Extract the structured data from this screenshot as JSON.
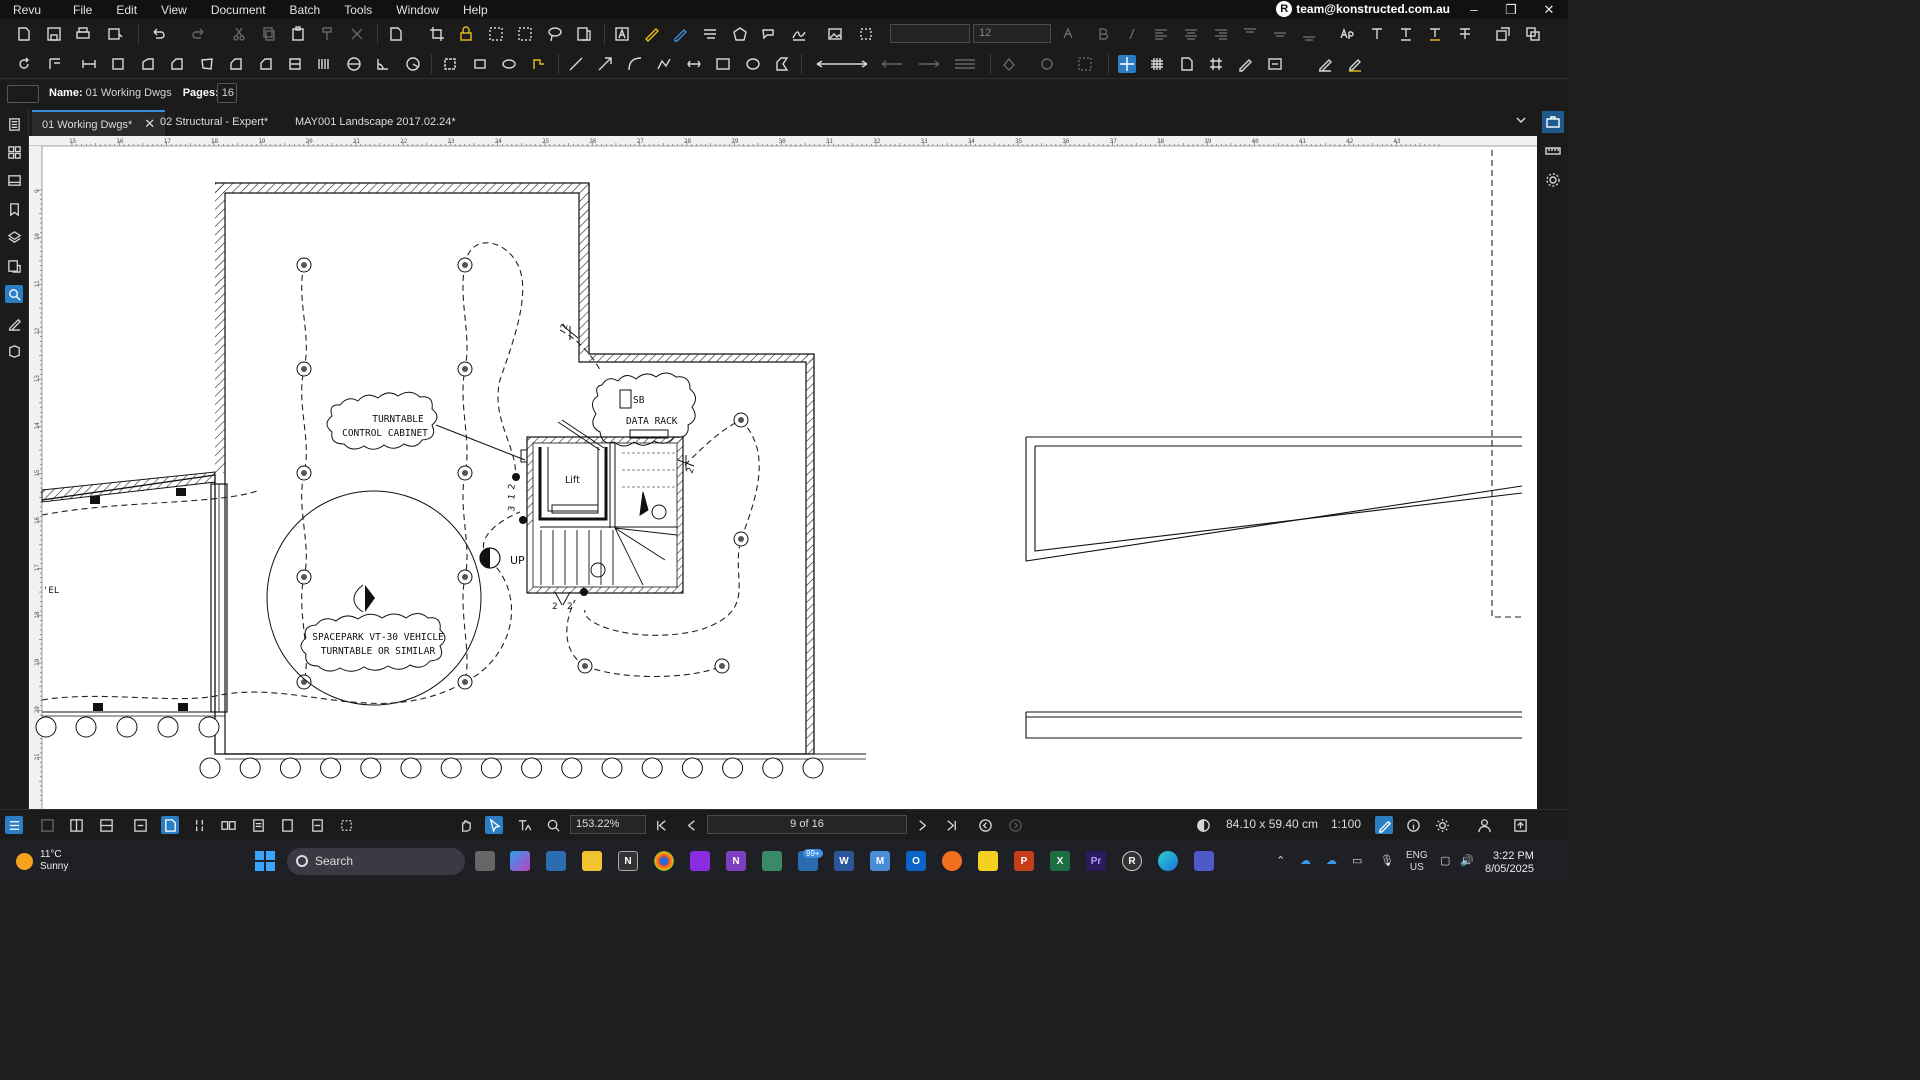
{
  "menu": [
    "Revu",
    "File",
    "Edit",
    "View",
    "Document",
    "Batch",
    "Tools",
    "Window",
    "Help"
  ],
  "account": "team@konstructed.com.au",
  "toolbar": {
    "font_size": "12"
  },
  "info": {
    "name_label": "Name:",
    "name_value": "01 Working Dwgs",
    "pages_label": "Pages:",
    "pages_value": "16"
  },
  "tabs": [
    {
      "label": "01 Working Dwgs*",
      "active": true
    },
    {
      "label": "02 Structural - Expert*",
      "active": false
    },
    {
      "label": "MAY001 Landscape 2017.02.24*",
      "active": false
    }
  ],
  "ruler_top": [
    "15",
    "16",
    "17",
    "18",
    "19",
    "20",
    "21",
    "22",
    "23",
    "24",
    "25",
    "26",
    "27",
    "28",
    "29",
    "30",
    "31",
    "32",
    "33",
    "34",
    "35",
    "36",
    "37",
    "38",
    "39",
    "40",
    "41",
    "42",
    "43"
  ],
  "ruler_left": [
    "9",
    "10",
    "11",
    "12",
    "13",
    "14",
    "15",
    "16",
    "17",
    "18",
    "19",
    "20",
    "21"
  ],
  "drawing": {
    "labels": {
      "cab1": "TURNTABLE",
      "cab2": "CONTROL CABINET",
      "sb": "SB",
      "rack": "DATA RACK",
      "lift": "Lift",
      "up": "UP",
      "tt1": "SPACEPARK VT-30 VEHICLE",
      "tt2": "TURNTABLE OR SIMILAR",
      "el": "'EL",
      "n2a": "2",
      "n2b": "2",
      "n2c": "2",
      "n2d": "2",
      "n3": "3",
      "n1": "1",
      "n2e": "2"
    }
  },
  "bottom": {
    "zoom": "153.22%",
    "page": "9 of 16",
    "sheet_size": "84.10 x 59.40 cm",
    "scale": "1:100"
  },
  "taskbar": {
    "temp": "11°C",
    "condition": "Sunny",
    "search": "Search",
    "badge": "99+",
    "lang1": "ENG",
    "lang2": "US",
    "time": "3:22 PM",
    "date": "8/05/2025"
  },
  "colors": {
    "accent": "#2c7ec4",
    "background": "#1b1b1b",
    "paper": "#ffffff"
  }
}
